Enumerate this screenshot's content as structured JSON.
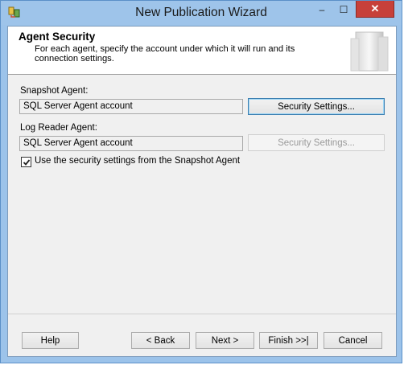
{
  "window": {
    "title": "New Publication Wizard"
  },
  "titlebar": {
    "minimize": "–",
    "maximize": "☐",
    "close": "✕"
  },
  "header": {
    "title": "Agent Security",
    "description": "For each agent, specify the account under which it will run and its connection settings."
  },
  "snapshot": {
    "label": "Snapshot Agent:",
    "account": "SQL Server Agent account",
    "button": "Security Settings..."
  },
  "logreader": {
    "label": "Log Reader Agent:",
    "account": "SQL Server Agent account",
    "button": "Security Settings..."
  },
  "use_snapshot_settings": {
    "label": "Use the security settings from the Snapshot Agent",
    "checked": true
  },
  "footer": {
    "help": "Help",
    "back": "< Back",
    "next": "Next >",
    "finish": "Finish >>|",
    "cancel": "Cancel"
  }
}
